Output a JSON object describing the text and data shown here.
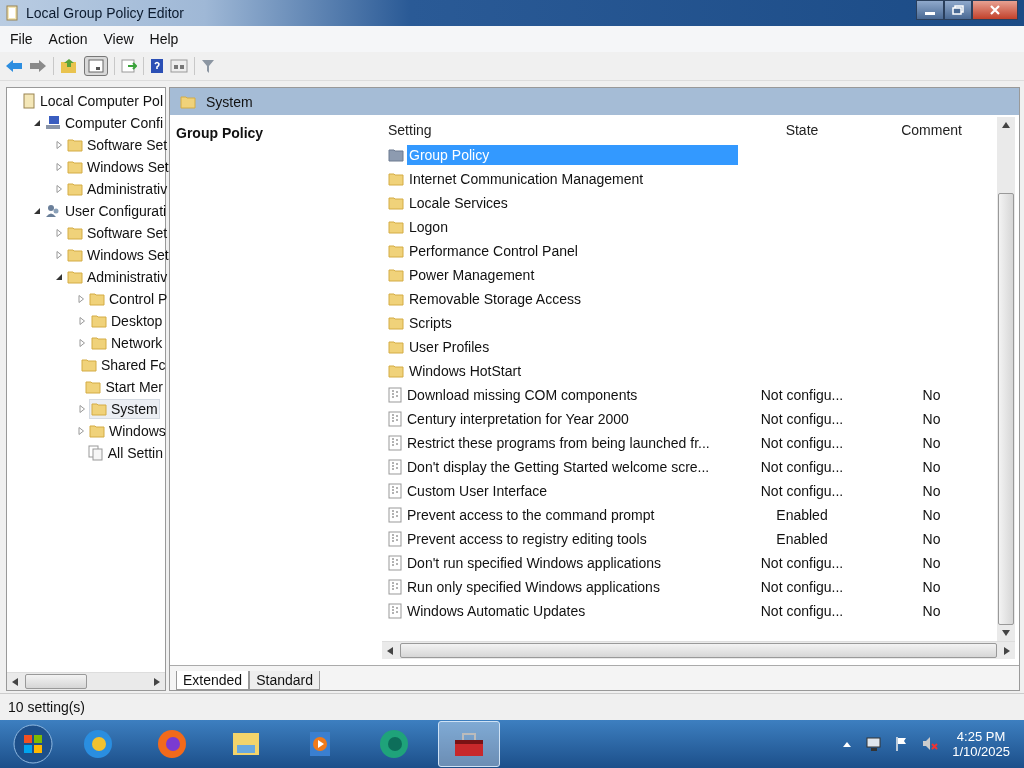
{
  "window": {
    "title": "Local Group Policy Editor"
  },
  "menu": [
    "File",
    "Action",
    "View",
    "Help"
  ],
  "tree": [
    {
      "label": "Local Computer Pol",
      "kind": "root",
      "selected": false,
      "children": [
        {
          "label": "Computer Confi",
          "kind": "computer",
          "expanded": true,
          "selected": false,
          "children": [
            {
              "label": "Software Set",
              "kind": "folder",
              "expanded": false,
              "selected": false
            },
            {
              "label": "Windows Set",
              "kind": "folder",
              "expanded": false,
              "selected": false
            },
            {
              "label": "Administrativ",
              "kind": "folder",
              "expanded": false,
              "selected": false
            }
          ]
        },
        {
          "label": "User Configurati",
          "kind": "user",
          "expanded": true,
          "selected": false,
          "children": [
            {
              "label": "Software Set",
              "kind": "folder",
              "expanded": false,
              "selected": false
            },
            {
              "label": "Windows Set",
              "kind": "folder",
              "expanded": false,
              "selected": false
            },
            {
              "label": "Administrativ",
              "kind": "folder",
              "expanded": true,
              "selected": false,
              "children": [
                {
                  "label": "Control P",
                  "kind": "folder",
                  "expanded": false,
                  "selected": false
                },
                {
                  "label": "Desktop",
                  "kind": "folder",
                  "expanded": false,
                  "selected": false
                },
                {
                  "label": "Network",
                  "kind": "folder",
                  "expanded": false,
                  "selected": false
                },
                {
                  "label": "Shared Fc",
                  "kind": "folder",
                  "selected": false
                },
                {
                  "label": "Start Mer",
                  "kind": "folder",
                  "selected": false
                },
                {
                  "label": "System",
                  "kind": "folder",
                  "expanded": false,
                  "selected": true
                },
                {
                  "label": "Windows",
                  "kind": "folder",
                  "expanded": false,
                  "selected": false
                },
                {
                  "label": "All Settin",
                  "kind": "all",
                  "selected": false
                }
              ]
            }
          ]
        }
      ]
    }
  ],
  "content": {
    "header": "System",
    "description_title": "Group Policy",
    "columns": [
      "Setting",
      "State",
      "Comment"
    ],
    "rows": [
      {
        "kind": "category",
        "setting": "Group Policy",
        "selected": true
      },
      {
        "kind": "folder",
        "setting": "Internet Communication Management",
        "selected": false
      },
      {
        "kind": "folder",
        "setting": "Locale Services",
        "selected": false
      },
      {
        "kind": "folder",
        "setting": "Logon",
        "selected": false
      },
      {
        "kind": "folder",
        "setting": "Performance Control Panel",
        "selected": false
      },
      {
        "kind": "folder",
        "setting": "Power Management",
        "selected": false
      },
      {
        "kind": "folder",
        "setting": "Removable Storage Access",
        "selected": false
      },
      {
        "kind": "folder",
        "setting": "Scripts",
        "selected": false
      },
      {
        "kind": "folder",
        "setting": "User Profiles",
        "selected": false
      },
      {
        "kind": "folder",
        "setting": "Windows HotStart",
        "selected": false
      },
      {
        "kind": "policy",
        "setting": "Download missing COM components",
        "state": "Not configu...",
        "comment": "No",
        "selected": false
      },
      {
        "kind": "policy",
        "setting": "Century interpretation for Year 2000",
        "state": "Not configu...",
        "comment": "No",
        "selected": false
      },
      {
        "kind": "policy",
        "setting": "Restrict these programs from being launched fr...",
        "state": "Not configu...",
        "comment": "No",
        "selected": false
      },
      {
        "kind": "policy",
        "setting": "Don't display the Getting Started welcome scre...",
        "state": "Not configu...",
        "comment": "No",
        "selected": false
      },
      {
        "kind": "policy",
        "setting": "Custom User Interface",
        "state": "Not configu...",
        "comment": "No",
        "selected": false
      },
      {
        "kind": "policy",
        "setting": "Prevent access to the command prompt",
        "state": "Enabled",
        "comment": "No",
        "selected": false
      },
      {
        "kind": "policy",
        "setting": "Prevent access to registry editing tools",
        "state": "Enabled",
        "comment": "No",
        "selected": false
      },
      {
        "kind": "policy",
        "setting": "Don't run specified Windows applications",
        "state": "Not configu...",
        "comment": "No",
        "selected": false
      },
      {
        "kind": "policy",
        "setting": "Run only specified Windows applications",
        "state": "Not configu...",
        "comment": "No",
        "selected": false
      },
      {
        "kind": "policy",
        "setting": "Windows Automatic Updates",
        "state": "Not configu...",
        "comment": "No",
        "selected": false
      }
    ],
    "tabs": [
      {
        "label": "Extended",
        "selected": true
      },
      {
        "label": "Standard",
        "selected": false
      }
    ]
  },
  "status_bar": "10 setting(s)",
  "taskbar": {
    "apps": [
      {
        "kind": "ie",
        "active": false
      },
      {
        "kind": "firefox",
        "active": false
      },
      {
        "kind": "explorer",
        "active": false
      },
      {
        "kind": "media",
        "active": false
      },
      {
        "kind": "green",
        "active": false
      },
      {
        "kind": "toolbox",
        "active": true
      }
    ],
    "time": "4:25 PM",
    "date": "1/10/2025"
  }
}
